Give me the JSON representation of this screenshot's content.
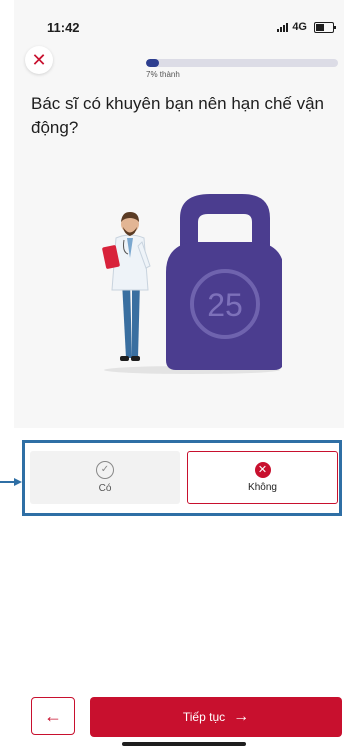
{
  "status_bar": {
    "time": "11:42",
    "network": "4G"
  },
  "header": {
    "close_icon": "close-icon",
    "progress_fraction": 0.07,
    "progress_label": "7% thành"
  },
  "question": "Bác sĩ có khuyên bạn nên hạn chế vận động?",
  "illustration": {
    "kettlebell_weight": "25"
  },
  "options": {
    "yes": {
      "label": "Có",
      "icon": "check-circle-icon",
      "selected": false
    },
    "no": {
      "label": "Không",
      "icon": "x-circle-icon",
      "selected": true
    }
  },
  "footer": {
    "back_icon": "arrow-left-icon",
    "continue_label": "Tiếp tục",
    "continue_icon": "arrow-right-icon"
  },
  "colors": {
    "accent": "#c8102e",
    "progress": "#2d3e8f",
    "kettlebell": "#4b3d8f",
    "annotation": "#2f6fa5"
  }
}
